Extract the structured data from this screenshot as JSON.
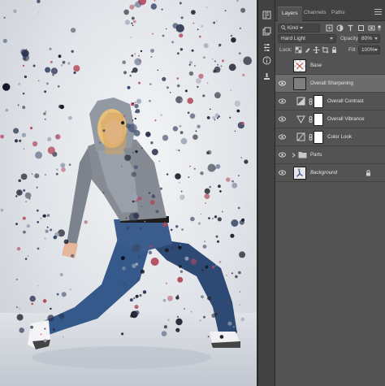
{
  "app": "Photoshop",
  "tabs": [
    {
      "label": "Layers",
      "active": true
    },
    {
      "label": "Channels",
      "active": false
    },
    {
      "label": "Paths",
      "active": false
    }
  ],
  "filter": {
    "kind_label": "Kind"
  },
  "blend": {
    "mode": "Hard Light",
    "opacity_label": "Opacity:",
    "opacity_value": "80%"
  },
  "lock": {
    "label": "Lock:",
    "fill_label": "Fill:",
    "fill_value": "100%"
  },
  "layers": [
    {
      "name": "Base",
      "visible": false,
      "type": "pixel",
      "selected": false
    },
    {
      "name": "Overall Sharpening",
      "visible": true,
      "type": "pixel",
      "selected": true
    },
    {
      "name": "Overall Contrast",
      "visible": true,
      "type": "adjustment-levels",
      "selected": false
    },
    {
      "name": "Overall Vibrance",
      "visible": true,
      "type": "adjustment-vibrance",
      "selected": false
    },
    {
      "name": "Color Look",
      "visible": true,
      "type": "adjustment-curves",
      "selected": false
    },
    {
      "name": "Parts",
      "visible": true,
      "type": "group",
      "selected": false
    },
    {
      "name": "Background",
      "visible": true,
      "type": "background",
      "selected": false,
      "locked": true
    }
  ],
  "tools": [
    "history-icon",
    "layer-comps-icon",
    "properties-icon",
    "info-icon",
    "brush-presets-icon"
  ],
  "colors": {
    "panel_bg": "#535353",
    "selected_row": "#6c6c6c",
    "tabbar": "#424242"
  }
}
